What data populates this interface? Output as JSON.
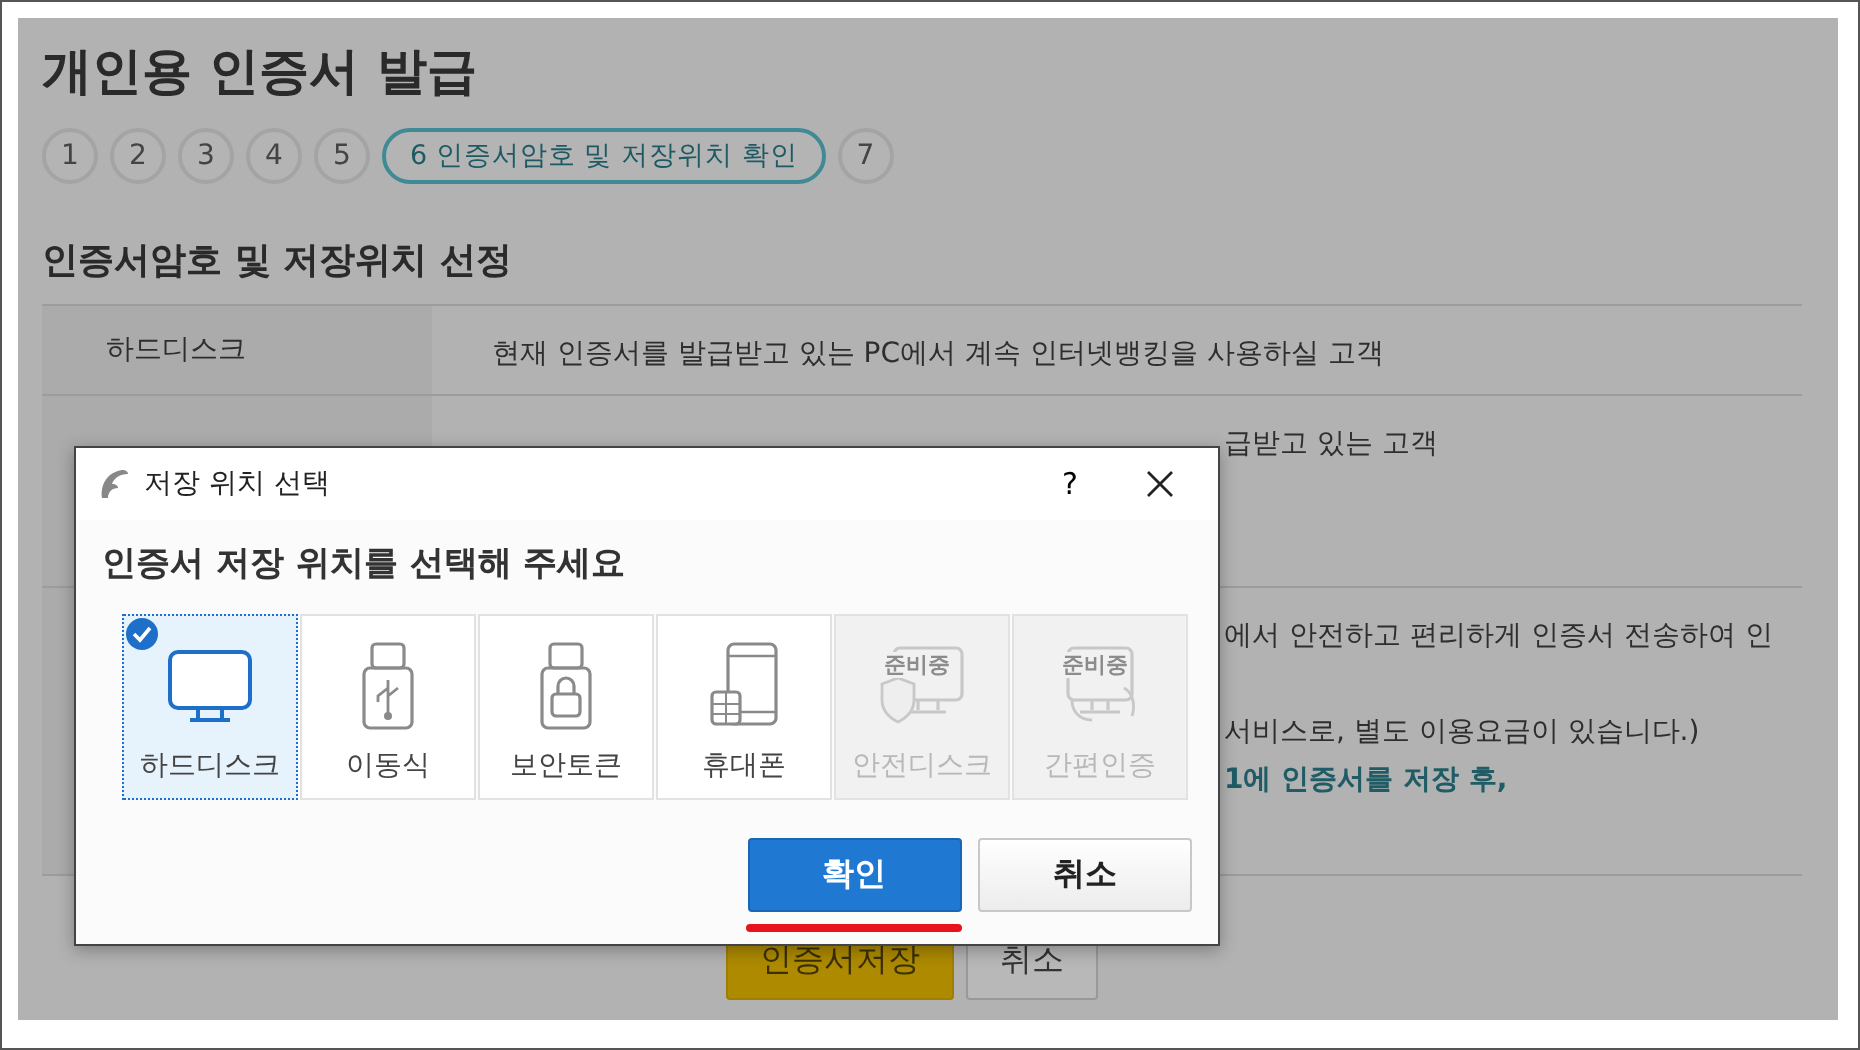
{
  "page": {
    "title": "개인용 인증서 발급",
    "steps": [
      {
        "label": "1",
        "selected": false
      },
      {
        "label": "2",
        "selected": false
      },
      {
        "label": "3",
        "selected": false
      },
      {
        "label": "4",
        "selected": false
      },
      {
        "label": "5",
        "selected": false
      },
      {
        "label": "6 인증서암호 및 저장위치 확인",
        "selected": true
      },
      {
        "label": "7",
        "selected": false
      }
    ],
    "section_title": "인증서암호 및 저장위치 선정",
    "table": {
      "rows": [
        {
          "label": "하드디스크",
          "lines": [
            {
              "text": "현재 인증서를 발급받고 있는 PC에서 계속 인터넷뱅킹을 사용하실 고객",
              "kind": "plain"
            }
          ]
        },
        {
          "lines": [
            {
              "text": "급받고 있는 고객",
              "kind": "plain"
            }
          ]
        },
        {
          "lines": [
            {
              "text": "에서 안전하고 편리하게 인증서 전송하여 인",
              "kind": "plain"
            },
            {
              "text": "서비스로, 별도 이용요금이 있습니다.)",
              "kind": "plain"
            },
            {
              "text": "1에 인증서를 저장 후,",
              "kind": "emphasis"
            }
          ]
        }
      ]
    },
    "buttons": [
      {
        "label": "인증서저장",
        "kind": "primary"
      },
      {
        "label": "취소",
        "kind": "secondary"
      }
    ]
  },
  "dialog": {
    "title": "저장 위치 선택",
    "help": "?",
    "heading": "인증서 저장 위치를 선택해 주세요",
    "options": [
      {
        "label": "하드디스크",
        "kind": "monitor",
        "selected": true,
        "disabled": false
      },
      {
        "label": "이동식",
        "kind": "usb",
        "selected": false,
        "disabled": false
      },
      {
        "label": "보안토큰",
        "kind": "token",
        "selected": false,
        "disabled": false
      },
      {
        "label": "휴대폰",
        "kind": "phone",
        "selected": false,
        "disabled": false
      },
      {
        "label": "안전디스크",
        "kind": "shield",
        "badge": "준비중",
        "selected": false,
        "disabled": true
      },
      {
        "label": "간편인증",
        "kind": "device",
        "badge": "준비중",
        "selected": false,
        "disabled": true
      }
    ],
    "buttons": [
      {
        "label": "확인",
        "kind": "primary",
        "underlined": true
      },
      {
        "label": "취소",
        "kind": "secondary",
        "underlined": false
      }
    ]
  }
}
